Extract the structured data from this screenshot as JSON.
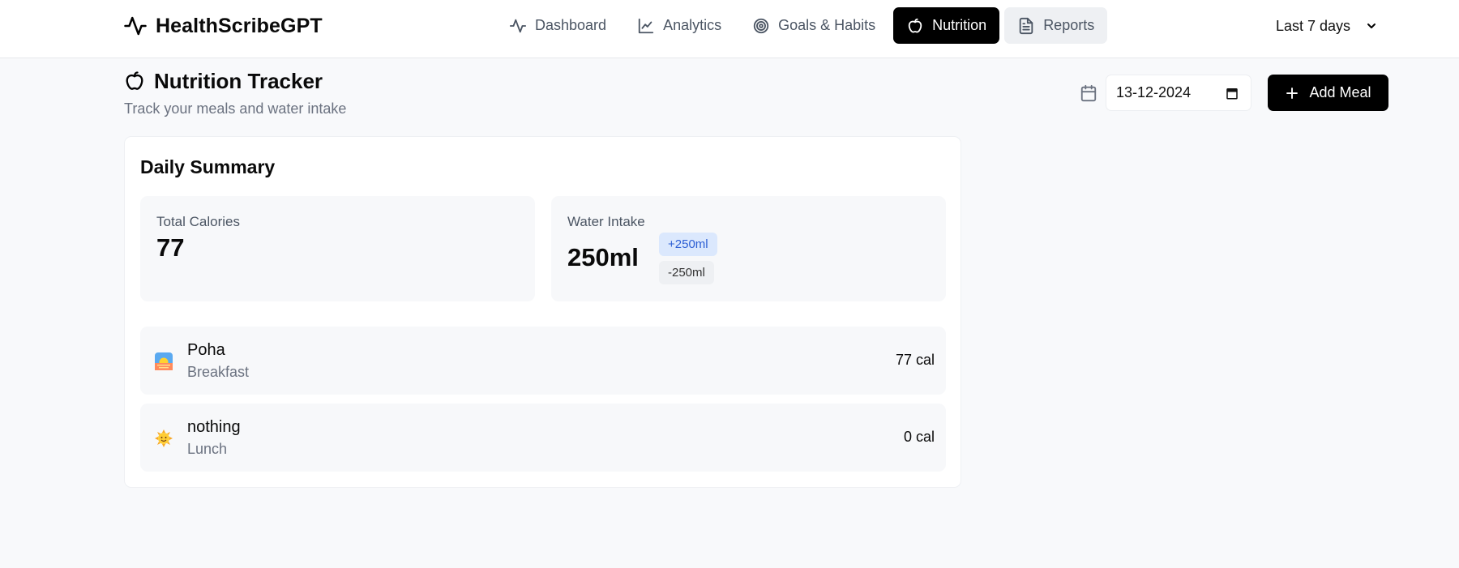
{
  "brand": {
    "name": "HealthScribeGPT"
  },
  "nav": {
    "items": [
      {
        "label": "Dashboard",
        "icon": "activity-icon"
      },
      {
        "label": "Analytics",
        "icon": "line-chart-icon"
      },
      {
        "label": "Goals & Habits",
        "icon": "target-icon"
      },
      {
        "label": "Nutrition",
        "icon": "apple-icon",
        "active": true
      },
      {
        "label": "Reports",
        "icon": "file-text-icon"
      }
    ]
  },
  "range": {
    "selected": "Last 7 days"
  },
  "page": {
    "title": "Nutrition Tracker",
    "subtitle": "Track your meals and water intake"
  },
  "controls": {
    "date_value": "13-12-2024",
    "add_meal_label": "Add Meal"
  },
  "summary": {
    "title": "Daily Summary",
    "calories_label": "Total Calories",
    "calories_value": "77",
    "water_label": "Water Intake",
    "water_value": "250ml",
    "water_add": "+250ml",
    "water_remove": "-250ml"
  },
  "meals": [
    {
      "name": "Poha",
      "type": "Breakfast",
      "calories": "77 cal",
      "icon": "sunrise-emoji-icon"
    },
    {
      "name": "nothing",
      "type": "Lunch",
      "calories": "0 cal",
      "icon": "sun-face-emoji-icon"
    }
  ],
  "colors": {
    "accent": "#000000",
    "water_add_bg": "#dbe8fd",
    "water_add_text": "#2d5fd4",
    "page_bg": "#f8f9fb"
  }
}
